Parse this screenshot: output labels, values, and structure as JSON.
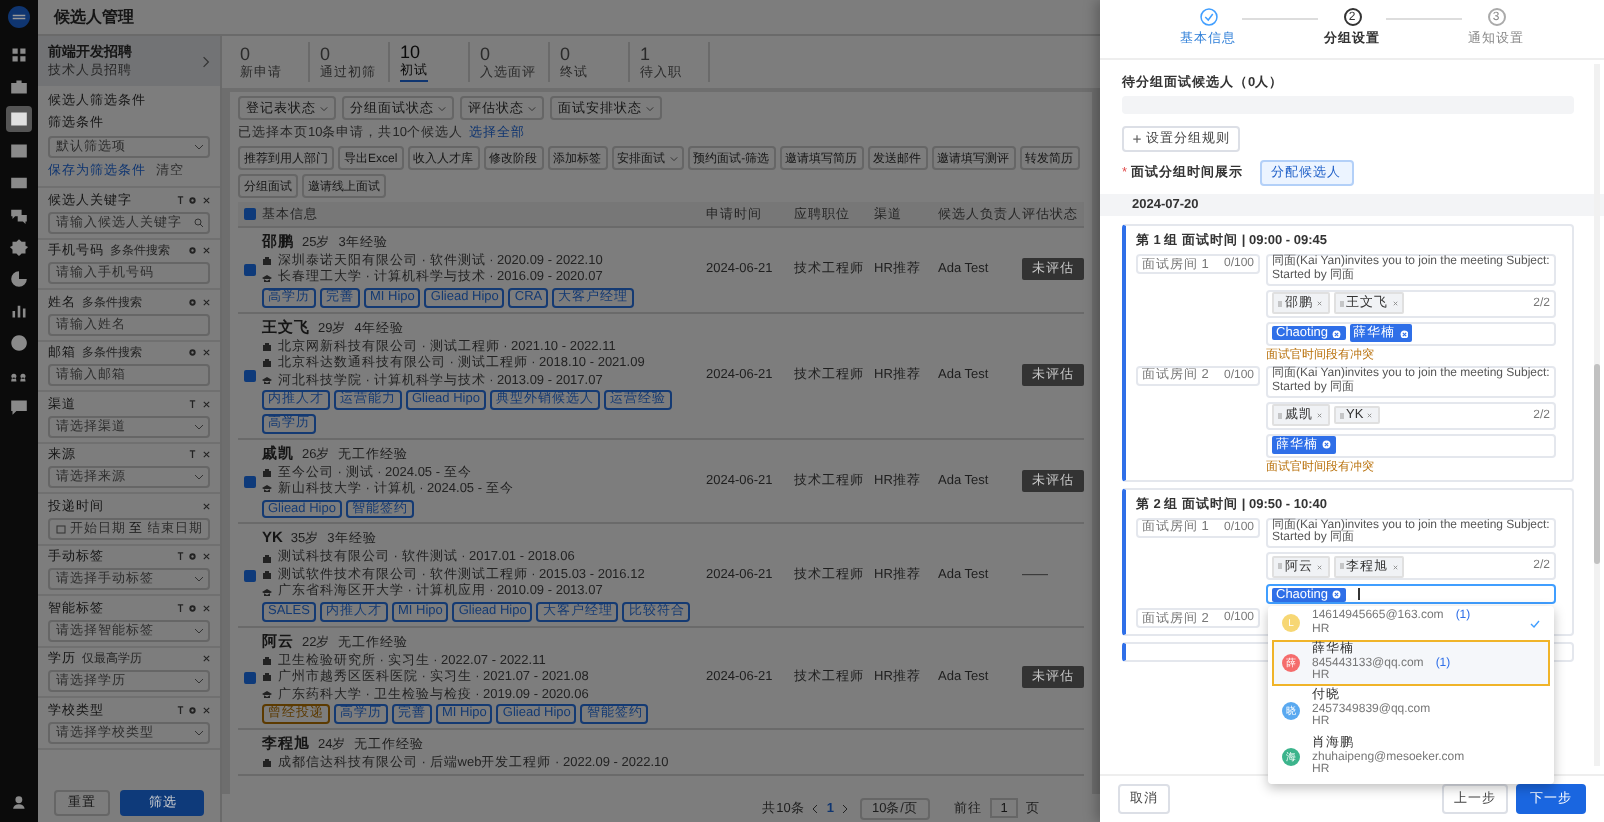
{
  "rail": [
    {
      "selected": false
    },
    {
      "selected": false
    },
    {
      "selected": true
    },
    {
      "selected": false
    },
    {
      "selected": false
    },
    {
      "selected": false
    },
    {
      "selected": false
    },
    {
      "selected": false
    },
    {
      "selected": false
    },
    {
      "selected": false
    },
    {
      "selected": false
    },
    {
      "selected": false
    }
  ],
  "page_title": "候选人管理",
  "sidebar": {
    "job_title": "前端开发招聘",
    "job_subtitle": "技术人员招聘",
    "section_title": "候选人筛选条件",
    "preset_label": "筛选条件",
    "preset_placeholder": "默认筛选项",
    "save_link": "保存为筛选条件",
    "clear_link": "清空",
    "filters": [
      {
        "label": "候选人关键字",
        "kind": "search",
        "placeholder": "请输入候选人关键字",
        "pin": true,
        "settings": true
      },
      {
        "label": "手机号码",
        "hint": "多条件搜索",
        "kind": "text",
        "placeholder": "请输入手机号码",
        "pin": false,
        "settings": true
      },
      {
        "label": "姓名",
        "hint": "多条件搜索",
        "kind": "text",
        "placeholder": "请输入姓名",
        "pin": false,
        "settings": true
      },
      {
        "label": "邮箱",
        "hint": "多条件搜索",
        "kind": "text",
        "placeholder": "请输入邮箱",
        "pin": false,
        "settings": true
      },
      {
        "label": "渠道",
        "kind": "select",
        "placeholder": "请选择渠道",
        "pin": true,
        "settings": false
      },
      {
        "label": "来源",
        "kind": "select",
        "placeholder": "请选择来源",
        "pin": true,
        "settings": false
      },
      {
        "label": "投递时间",
        "kind": "daterange",
        "start_placeholder": "开始日期",
        "separator": "至",
        "end_placeholder": "结束日期",
        "pin": false,
        "settings": false
      },
      {
        "label": "手动标签",
        "kind": "select",
        "placeholder": "请选择手动标签",
        "pin": true,
        "settings": true
      },
      {
        "label": "智能标签",
        "kind": "select",
        "placeholder": "请选择智能标签",
        "pin": true,
        "settings": true
      },
      {
        "label": "学历",
        "hint": "仅最高学历",
        "kind": "select",
        "placeholder": "请选择学历",
        "pin": false,
        "settings": false
      },
      {
        "label": "学校类型",
        "kind": "select",
        "placeholder": "请选择学校类型",
        "pin": true,
        "settings": true
      }
    ],
    "reset_button": "重置",
    "filter_button": "筛选"
  },
  "stages": [
    {
      "count": "0",
      "label": "新申请",
      "selected": false
    },
    {
      "count": "0",
      "label": "通过初筛",
      "selected": false
    },
    {
      "count": "10",
      "label": "初试",
      "selected": true
    },
    {
      "count": "0",
      "label": "入选面评",
      "selected": false
    },
    {
      "count": "0",
      "label": "终试",
      "selected": false
    },
    {
      "count": "1",
      "label": "待入职",
      "selected": false
    }
  ],
  "dropdown_filters": [
    "登记表状态",
    "分组面试状态",
    "评估状态",
    "面试安排状态"
  ],
  "selection_info": "已选择本页10条申请，共10个候选人",
  "select_all_link": "选择全部",
  "actions": [
    {
      "label": "推荐到用人部门",
      "dropdown": false
    },
    {
      "label": "导出Excel",
      "dropdown": false
    },
    {
      "label": "收入人才库",
      "dropdown": false
    },
    {
      "label": "修改阶段",
      "dropdown": false
    },
    {
      "label": "添加标签",
      "dropdown": false
    },
    {
      "label": "安排面试",
      "dropdown": true
    },
    {
      "label": "预约面试-筛选",
      "dropdown": false
    },
    {
      "label": "邀请填写简历",
      "dropdown": false
    },
    {
      "label": "发送邮件",
      "dropdown": false
    },
    {
      "label": "邀请填写测评",
      "dropdown": false
    },
    {
      "label": "转发简历",
      "dropdown": false
    },
    {
      "label": "分组面试",
      "dropdown": false
    },
    {
      "label": "邀请线上面试",
      "dropdown": false
    }
  ],
  "table": {
    "all_checked": true,
    "columns": [
      "基本信息",
      "申请时间",
      "应聘职位",
      "渠道",
      "候选人负责人",
      "评估状态"
    ],
    "rows": [
      {
        "checked": true,
        "name": "邵鹏",
        "age": "25岁",
        "experience": "3年经验",
        "history": [
          {
            "kind": "work",
            "text": "深圳泰诺天阳有限公司 · 软件测试 · 2020.09 - 2022.10"
          },
          {
            "kind": "school",
            "text": "长春理工大学 · 计算机科学与技术 · 2016.09 - 2020.07"
          }
        ],
        "tags": [
          {
            "text": "高学历",
            "color": "#143a73"
          },
          {
            "text": "完善",
            "color": "#143a73"
          },
          {
            "text": "MI Hipo",
            "color": "#143a73"
          },
          {
            "text": "Gliead Hipo",
            "color": "#143a73"
          },
          {
            "text": "CRA",
            "color": "#143a73"
          },
          {
            "text": "大客户经理",
            "color": "#143a73"
          }
        ],
        "date": "2024-06-21",
        "position": "技术工程师",
        "channel": "HR推荐",
        "owner": "Ada Test",
        "status": {
          "kind": "badge",
          "text": "未评估"
        }
      },
      {
        "checked": true,
        "name": "王文飞",
        "age": "29岁",
        "experience": "4年经验",
        "history": [
          {
            "kind": "work",
            "text": "北京网新科技有限公司 · 测试工程师 · 2021.10 - 2022.11"
          },
          {
            "kind": "work",
            "text": "北京科达数通科技有限公司 · 测试工程师 · 2018.10 - 2021.09"
          },
          {
            "kind": "school",
            "text": "河北科技学院 · 计算机科学与技术 · 2013.09 - 2017.07"
          }
        ],
        "tags": [
          {
            "text": "内推人才",
            "color": "#143a73"
          },
          {
            "text": "运营能力",
            "color": "#143a73"
          },
          {
            "text": "Gliead Hipo",
            "color": "#143a73"
          },
          {
            "text": "典型外销候选人",
            "color": "#143a73"
          },
          {
            "text": "运营经验",
            "color": "#143a73"
          },
          {
            "text": "高学历",
            "color": "#143a73"
          }
        ],
        "date": "2024-06-21",
        "position": "技术工程师",
        "channel": "HR推荐",
        "owner": "Ada Test",
        "status": {
          "kind": "badge",
          "text": "未评估"
        }
      },
      {
        "checked": true,
        "name": "戚凯",
        "age": "26岁",
        "experience": "无工作经验",
        "history": [
          {
            "kind": "work",
            "text": "至今公司 · 测试 · 2024.05 - 至今"
          },
          {
            "kind": "school",
            "text": "新山科技大学 · 计算机 · 2024.05 - 至今"
          }
        ],
        "tags": [
          {
            "text": "Gliead Hipo",
            "color": "#143a73"
          },
          {
            "text": "智能签约",
            "color": "#143a73"
          }
        ],
        "date": "2024-06-21",
        "position": "技术工程师",
        "channel": "HR推荐",
        "owner": "Ada Test",
        "status": {
          "kind": "badge",
          "text": "未评估"
        }
      },
      {
        "checked": true,
        "name": "YK",
        "age": "35岁",
        "experience": "3年经验",
        "history": [
          {
            "kind": "work",
            "text": "测试科技有限公司 · 软件测试 · 2017.01 - 2018.06"
          },
          {
            "kind": "work",
            "text": "测试软件技术有限公司 · 软件测试工程师 · 2015.03 - 2016.12"
          },
          {
            "kind": "school",
            "text": "广东省科海区开大学 · 计算机应用 · 2010.09 - 2013.07"
          }
        ],
        "tags": [
          {
            "text": "SALES",
            "color": "#143a73"
          },
          {
            "text": "内推人才",
            "color": "#143a73"
          },
          {
            "text": "MI Hipo",
            "color": "#143a73"
          },
          {
            "text": "Gliead Hipo",
            "color": "#143a73"
          },
          {
            "text": "大客户经理",
            "color": "#143a73"
          },
          {
            "text": "比较符合",
            "color": "#143a73"
          }
        ],
        "date": "2024-06-21",
        "position": "技术工程师",
        "channel": "HR推荐",
        "owner": "Ada Test",
        "status": {
          "kind": "plain",
          "text": "——"
        }
      },
      {
        "checked": true,
        "name": "阿云",
        "age": "22岁",
        "experience": "无工作经验",
        "history": [
          {
            "kind": "work",
            "text": "卫生检验研究所 · 实习生 · 2022.07 - 2022.11"
          },
          {
            "kind": "work",
            "text": "广州市越秀区医科医院 · 实习生 · 2021.07 - 2021.08"
          },
          {
            "kind": "school",
            "text": "广东药科大学 · 卫生检验与检疫 · 2019.09 - 2020.06"
          }
        ],
        "tags": [
          {
            "text": "曾经投递",
            "color": "#5c3a00"
          },
          {
            "text": "高学历",
            "color": "#143a73"
          },
          {
            "text": "完善",
            "color": "#143a73"
          },
          {
            "text": "MI Hipo",
            "color": "#143a73"
          },
          {
            "text": "Gliead Hipo",
            "color": "#143a73"
          },
          {
            "text": "智能签约",
            "color": "#143a73"
          }
        ],
        "date": "2024-06-21",
        "position": "技术工程师",
        "channel": "HR推荐",
        "owner": "Ada Test",
        "status": {
          "kind": "badge",
          "text": "未评估"
        }
      },
      {
        "name": "李程旭",
        "age": "24岁",
        "experience": "无工作经验",
        "history": [
          {
            "kind": "work",
            "text": "成都信达科技有限公司 · 后端web开发工程师 · 2022.09 - 2022.10"
          }
        ]
      }
    ]
  },
  "pagination": {
    "total": "共10条",
    "page": "1",
    "page_size": "10条/页",
    "goto_label": "前往",
    "goto_value": "1",
    "goto_unit": "页"
  },
  "drawer": {
    "steps": [
      {
        "label": "基本信息",
        "completed": true,
        "active": false
      },
      {
        "number": "2",
        "label": "分组设置",
        "completed": false,
        "active": true
      },
      {
        "number": "3",
        "label": "通知设置",
        "completed": false,
        "active": false
      }
    ],
    "pending_label": "待分组面试候选人（0人）",
    "rule_button": "设置分组规则",
    "required_mark": "*",
    "display_label": "面试分组时间展示",
    "assign_button": "分配候选人",
    "date": "2024-07-20",
    "groups": [
      {
        "title": "第 1 组 面试时间 | 09:00 - 09:45",
        "rooms": [
          {
            "room_placeholder": "面试房间 1",
            "counter": "0/100",
            "meeting": "同面(Kai Yan)invites you to join the meeting Subject: Started by 同面",
            "candidates": [
              "邵鹏",
              "王文飞"
            ],
            "candidate_count": "2/2",
            "interviewers": [
              "Chaoting",
              "薛华楠"
            ],
            "warning": "面试官时间段有冲突",
            "focused": false
          },
          {
            "room_placeholder": "面试房间 2",
            "counter": "0/100",
            "meeting": "同面(Kai Yan)invites you to join the meeting Subject: Started by 同面",
            "candidates": [
              "戚凯",
              "YK"
            ],
            "candidate_count": "2/2",
            "interviewers": [
              "薛华楠"
            ],
            "warning": "面试官时间段有冲突",
            "focused": false
          }
        ]
      },
      {
        "title": "第 2 组 面试时间 | 09:50 - 10:40",
        "rooms": [
          {
            "room_placeholder": "面试房间 1",
            "counter": "0/100",
            "meeting": "同面(Kai Yan)invites you to join the meeting Subject: Started by 同面",
            "candidates": [
              "阿云",
              "李程旭"
            ],
            "candidate_count": "2/2",
            "interviewers": [
              "Chaoting"
            ],
            "focused": true,
            "options": [
              {
                "avatar": "L",
                "color": "#f7d774",
                "email": "14614945665@163.com",
                "count": "(1)",
                "role": "HR",
                "selected": true,
                "highlighted": false
              },
              {
                "avatar": "薛",
                "color": "#f56c6c",
                "name": "薛华楠",
                "email": "845443133@qq.com",
                "count": "(1)",
                "role": "HR",
                "selected": false,
                "highlighted": true
              },
              {
                "avatar": "晓",
                "color": "#5aa9f0",
                "name": "付晓",
                "email": "2457349839@qq.com",
                "role": "HR",
                "selected": false,
                "highlighted": false
              },
              {
                "avatar": "海",
                "color": "#3cb48c",
                "name": "肖海鹏",
                "email": "zhuhaipeng@mesoeker.com",
                "role": "HR",
                "selected": false,
                "highlighted": false
              }
            ]
          },
          {
            "room_placeholder": "面试房间 2",
            "counter": "0/100"
          }
        ]
      }
    ],
    "cancel_button": "取消",
    "prev_button": "上一步",
    "next_button": "下一步"
  }
}
